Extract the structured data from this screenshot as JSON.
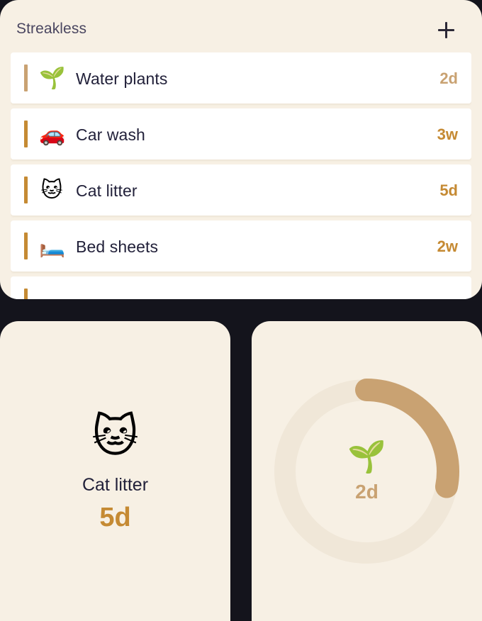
{
  "app": {
    "title": "Streakless",
    "add_label": "+"
  },
  "list": {
    "items": [
      {
        "emoji": "🌱",
        "name": "Water plants",
        "age": "2d",
        "accent_color": "#c9a272",
        "age_color": "#c9a272"
      },
      {
        "emoji": "🚗",
        "name": "Car wash",
        "age": "3w",
        "accent_color": "#c58a33",
        "age_color": "#c58a33"
      },
      {
        "emoji": "🐱",
        "name": "Cat litter",
        "age": "5d",
        "accent_color": "#c58a33",
        "age_color": "#c58a33"
      },
      {
        "emoji": "🛏️",
        "name": "Bed sheets",
        "age": "2w",
        "accent_color": "#c58a33",
        "age_color": "#c58a33"
      },
      {
        "emoji": "",
        "name": "",
        "age": "",
        "accent_color": "#c58a33",
        "age_color": "#c58a33"
      }
    ]
  },
  "single_widget": {
    "emoji": "🐱",
    "name": "Cat litter",
    "age": "5d",
    "age_color": "#c58a33"
  },
  "ring_widget": {
    "emoji": "🌱",
    "age": "2d",
    "progress": 0.28,
    "track_color": "#f0e7d8",
    "progress_color": "#c9a272"
  },
  "colors": {
    "background": "#14141c",
    "widget_background": "#f7f0e4",
    "text_primary": "#22213a",
    "text_secondary": "#4a4660"
  }
}
